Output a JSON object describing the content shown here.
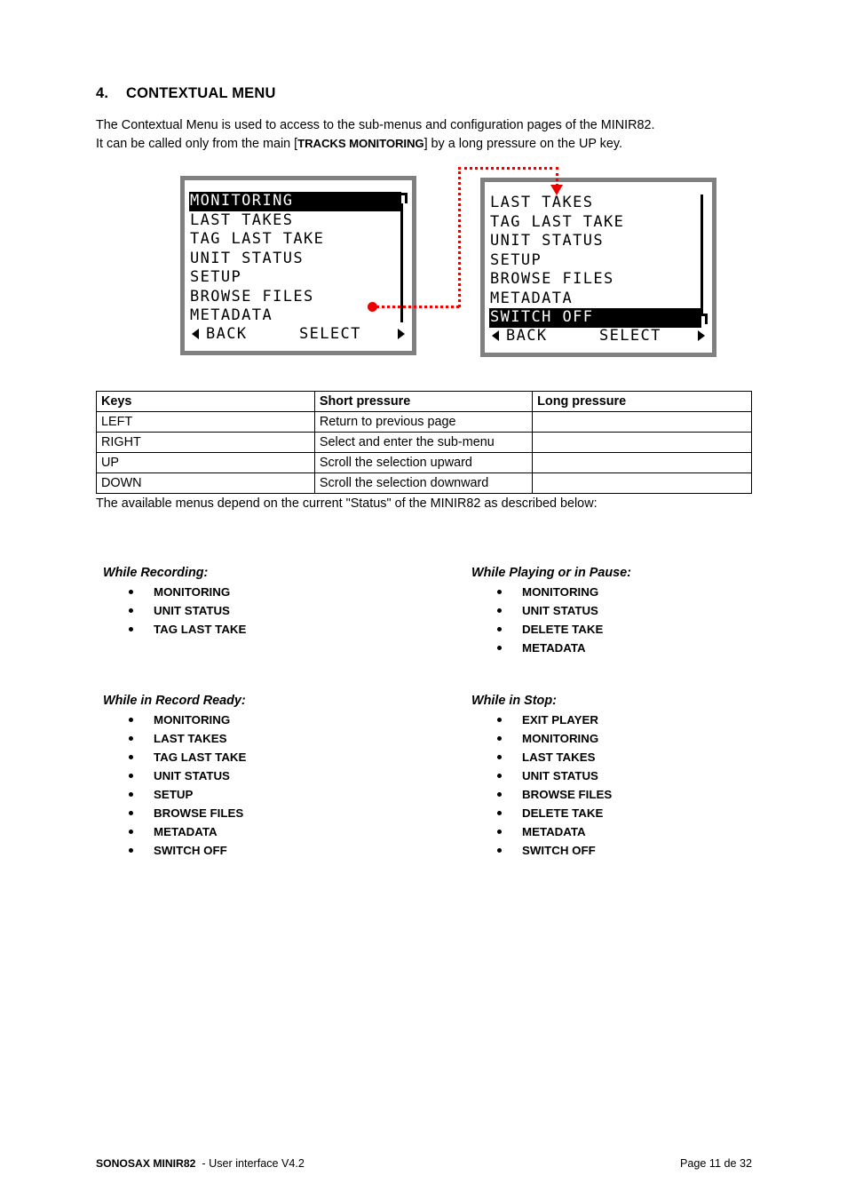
{
  "heading": {
    "number": "4.",
    "title": "CONTEXTUAL MENU"
  },
  "intro": {
    "line1": "The Contextual Menu is used to access to the sub-menus and configuration pages of the MINIR82.",
    "line2_a": "It can be called only from the main [",
    "line2_b": "TRACKS MONITORING",
    "line2_c": "] by a long pressure on the UP key."
  },
  "lcd1": {
    "items": [
      "MONITORING",
      "LAST TAKES",
      "TAG LAST TAKE",
      "UNIT STATUS",
      "SETUP",
      "BROWSE FILES",
      "METADATA"
    ],
    "selected_index": 0,
    "footer": {
      "back": "BACK",
      "select": "SELECT"
    }
  },
  "lcd2": {
    "items": [
      "LAST TAKES",
      "TAG LAST TAKE",
      "UNIT STATUS",
      "SETUP",
      "BROWSE FILES",
      "METADATA",
      "SWITCH OFF"
    ],
    "selected_index": 6,
    "footer": {
      "back": "BACK",
      "select": "SELECT"
    }
  },
  "connector": {
    "color": "#ee0000"
  },
  "keys_table": {
    "headers": [
      "Keys",
      "Short pressure",
      "Long pressure"
    ],
    "rows": [
      [
        "LEFT",
        "Return to previous page",
        ""
      ],
      [
        "RIGHT",
        "Select and enter the sub-menu",
        ""
      ],
      [
        "UP",
        "Scroll the selection upward",
        ""
      ],
      [
        "DOWN",
        "Scroll the selection downward",
        ""
      ]
    ]
  },
  "status_line": "The available menus depend on the current \"Status\" of the MINIR82 as described below:",
  "groups": {
    "recording": {
      "title": "While Recording:",
      "items": [
        "MONITORING",
        "UNIT STATUS",
        "TAG LAST TAKE"
      ]
    },
    "playing": {
      "title": "While Playing or in Pause:",
      "items": [
        "MONITORING",
        "UNIT STATUS",
        "DELETE TAKE",
        "METADATA"
      ]
    },
    "record_ready": {
      "title": "While in Record Ready:",
      "items": [
        "MONITORING",
        "LAST TAKES",
        "TAG LAST TAKE",
        "UNIT STATUS",
        "SETUP",
        "BROWSE FILES",
        "METADATA",
        "SWITCH OFF"
      ]
    },
    "stop": {
      "title": "While in Stop:",
      "items": [
        "EXIT PLAYER",
        "MONITORING",
        "LAST TAKES",
        "UNIT STATUS",
        "BROWSE FILES",
        "DELETE TAKE",
        "METADATA",
        "SWITCH OFF"
      ]
    }
  },
  "footer": {
    "product": "SONOSAX MINIR82",
    "doc": "-  User interface  V4.2",
    "page": "Page 11 de 32"
  }
}
